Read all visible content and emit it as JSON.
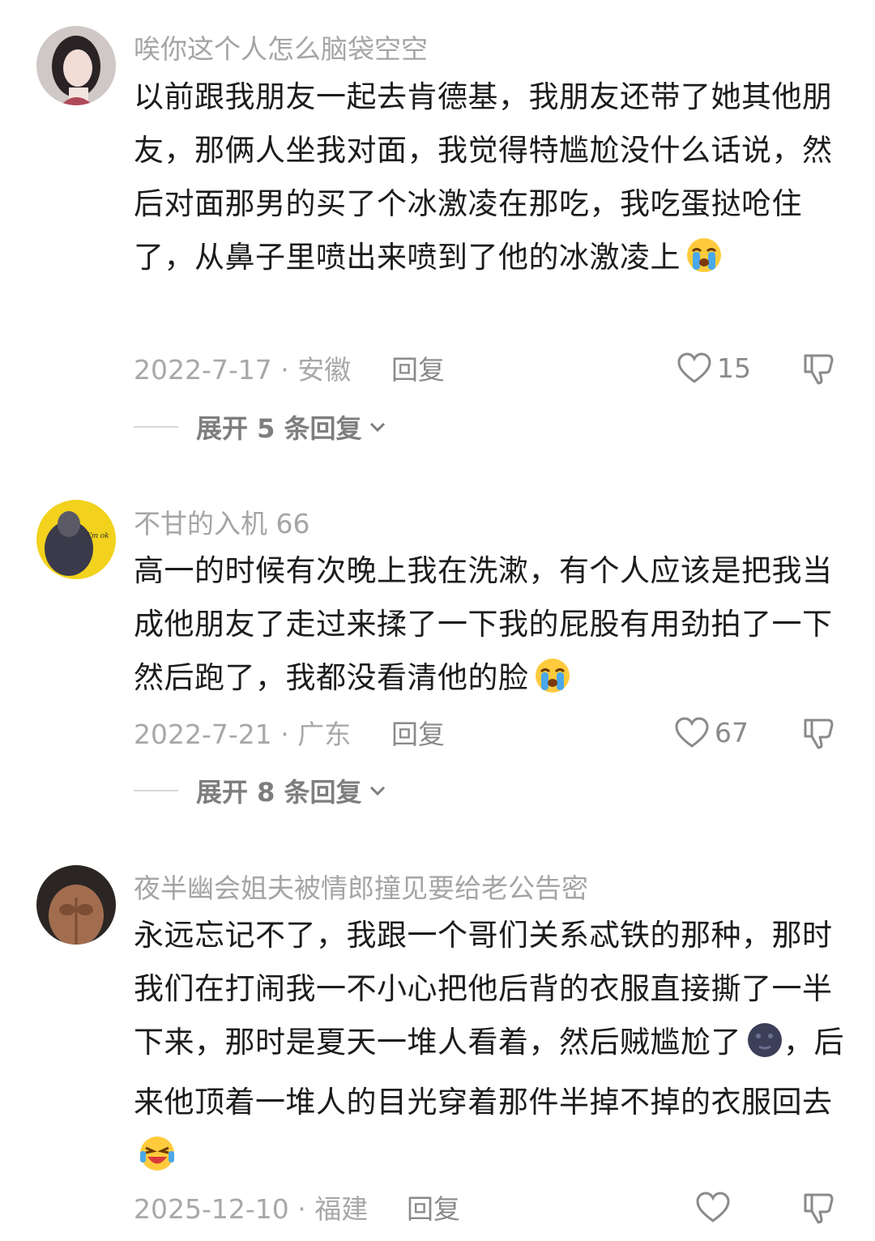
{
  "comments": [
    {
      "username": "唉你这个人怎么脑袋空空",
      "text": "以前跟我朋友一起去肯德基，我朋友还带了她其他朋友，那俩人坐我对面，我觉得特尴尬没什么话说，然后对面那男的买了个冰激凌在那吃，我吃蛋挞呛住了，从鼻子里喷出来喷到了他的冰激凌上",
      "emoji": "loudly-crying-face-icon",
      "date": "2022-7-17 · 安徽",
      "reply_label": "回复",
      "likes": "15",
      "expand_label": "展开 5 条回复"
    },
    {
      "username": "不甘的入机 66",
      "text": "高一的时候有次晚上我在洗漱，有个人应该是把我当成他朋友了走过来揉了一下我的屁股有用劲拍了一下然后跑了，我都没看清他的脸",
      "emoji": "loudly-crying-face-icon",
      "date": "2022-7-21 · 广东",
      "reply_label": "回复",
      "likes": "67",
      "expand_label": "展开 8 条回复"
    },
    {
      "username": "夜半幽会姐夫被情郎撞见要给老公告密",
      "text_part1": "永远忘记不了，我跟一个哥们关系忒铁的那种，那时我们在打闹我一不小心把他后背的衣服直接撕了一半下来，那时是夏天一堆人看着，然后贼尴尬了",
      "text_part2": "，后来他顶着一堆人的目光穿着那件半掉不掉的衣服回去",
      "emoji_mid": "new-moon-face-icon",
      "emoji_end": "rolling-laughing-face-icon",
      "date": "2025-12-10 · 福建",
      "reply_label": "回复",
      "likes": ""
    }
  ]
}
